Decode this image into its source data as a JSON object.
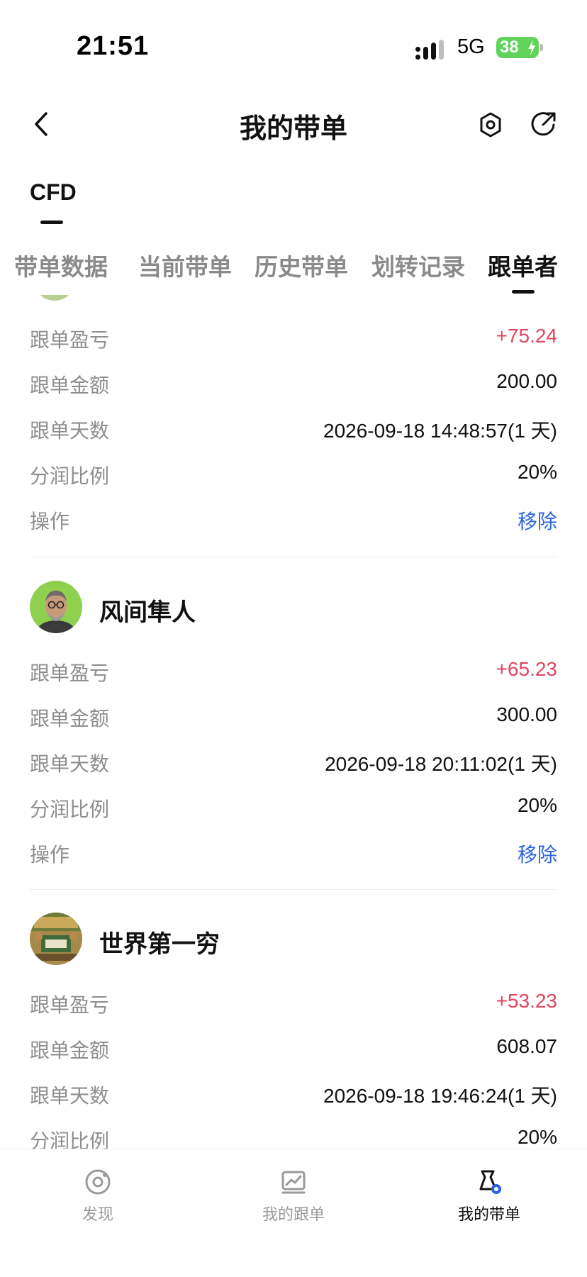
{
  "status_bar": {
    "time": "21:51",
    "network": "5G",
    "battery": "38"
  },
  "nav": {
    "title": "我的带单"
  },
  "category": {
    "label": "CFD"
  },
  "tabs": [
    {
      "label": "带单数据"
    },
    {
      "label": "当前带单"
    },
    {
      "label": "历史带单"
    },
    {
      "label": "划转记录"
    },
    {
      "label": "跟单者",
      "active": true
    }
  ],
  "fields": {
    "pnl": "跟单盈亏",
    "amount": "跟单金额",
    "days": "跟单天数",
    "share": "分润比例",
    "action": "操作"
  },
  "followers": [
    {
      "name": "",
      "pnl": "+75.24",
      "amount": "200.00",
      "days": "2026-09-18 14:48:57(1 天)",
      "share": "20%",
      "action": "移除"
    },
    {
      "name": "风间隼人",
      "pnl": "+65.23",
      "amount": "300.00",
      "days": "2026-09-18 20:11:02(1 天)",
      "share": "20%",
      "action": "移除"
    },
    {
      "name": "世界第一穷",
      "pnl": "+53.23",
      "amount": "608.07",
      "days": "2026-09-18 19:46:24(1 天)",
      "share": "20%",
      "action": ""
    }
  ],
  "bottom_nav": [
    {
      "label": "发现",
      "icon": "discover-icon"
    },
    {
      "label": "我的跟单",
      "icon": "chart-icon"
    },
    {
      "label": "我的带单",
      "icon": "flask-icon",
      "active": true
    }
  ],
  "colors": {
    "profit": "#e2455f",
    "link": "#2a64e0",
    "battery": "#5fd35a"
  }
}
